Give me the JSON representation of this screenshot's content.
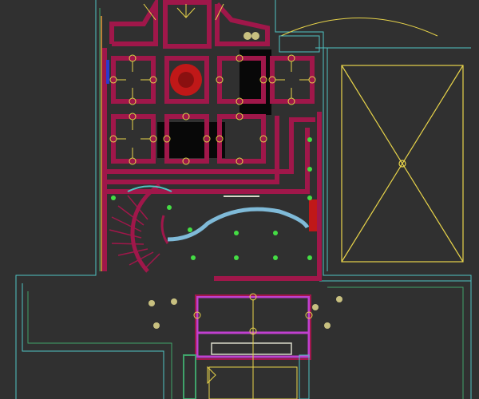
{
  "view": {
    "type": "cad-floor-plan-viewport"
  },
  "colors": {
    "background": "#303030",
    "wall": "#a0174a",
    "outline_cyan": "#4fc3c3",
    "outline_green": "#3fa36a",
    "fixture_yellow": "#e8d44a",
    "light_green": "#44dd44",
    "magenta": "#c040d0",
    "furniture_black": "#080808",
    "orange": "#e89a3a",
    "white_line": "#d8d8c8"
  }
}
